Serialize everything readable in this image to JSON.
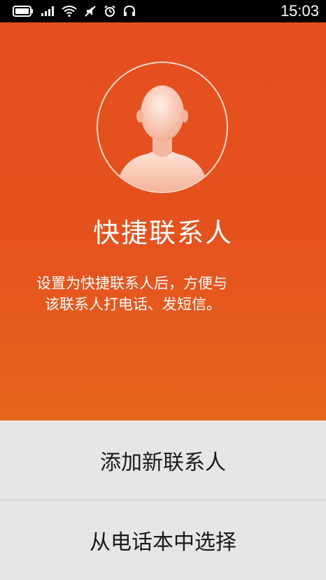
{
  "status_bar": {
    "time": "15:03",
    "icons": [
      "battery-icon",
      "signal-icon",
      "wifi-icon",
      "mute-icon",
      "alarm-icon",
      "headset-icon"
    ]
  },
  "hero": {
    "avatar_icon": "person-silhouette-icon",
    "title": "快捷联系人",
    "description_line1": "设置为快捷联系人后，方便与",
    "description_line2": "该联系人打电话、发短信。"
  },
  "actions": {
    "add_new_contact": "添加新联系人",
    "choose_from_phonebook": "从电话本中选择"
  },
  "colors": {
    "accent": "#e5531e",
    "status_bar": "#000000",
    "action_background": "#e6e6e6"
  }
}
